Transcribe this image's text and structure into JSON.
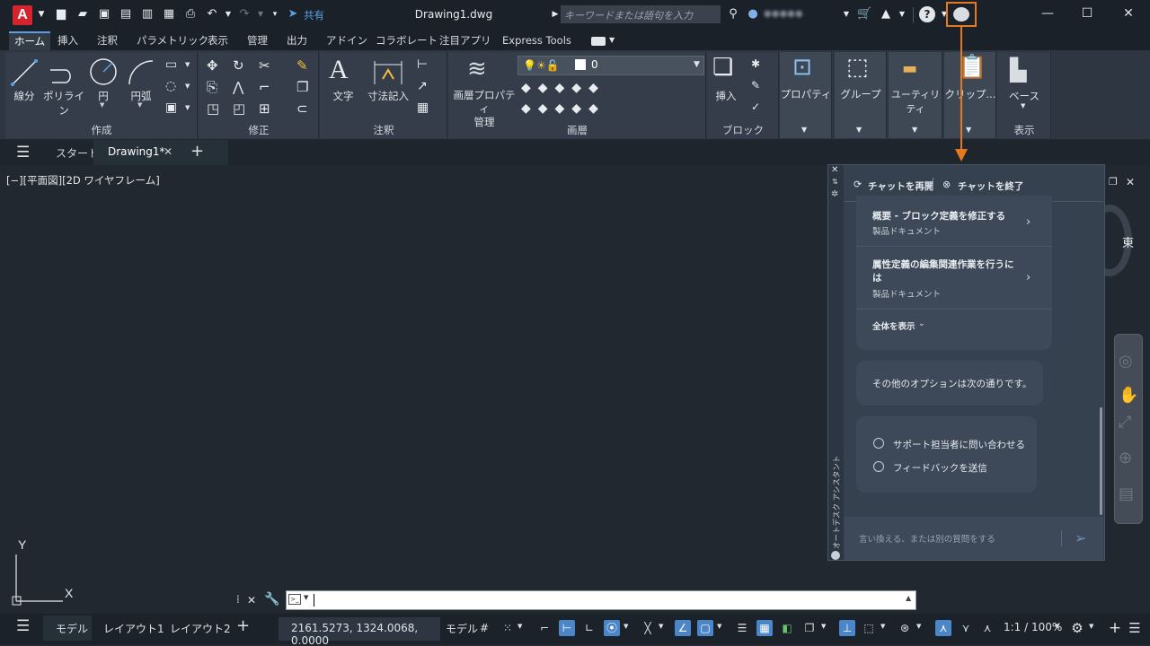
{
  "window": {
    "title": "Drawing1.dwg",
    "search_placeholder": "キーワードまたは語句を入力",
    "share": "共有",
    "user_name": "●●●●●"
  },
  "ribbon_tabs": [
    "ホーム",
    "挿入",
    "注釈",
    "パラメトリック",
    "表示",
    "管理",
    "出力",
    "アドイン",
    "コラボレート",
    "注目アプリ",
    "Express Tools"
  ],
  "ribbon": {
    "draw": {
      "line": "線分",
      "polyline": "ポリライン",
      "circle": "円",
      "arc": "円弧",
      "panel": "作成"
    },
    "modify": {
      "panel": "修正"
    },
    "annotation": {
      "text": "文字",
      "dimension": "寸法記入",
      "panel": "注釈"
    },
    "layers": {
      "properties": "画層プロパティ\n管理",
      "current_layer": "0",
      "panel": "画層"
    },
    "block": {
      "insert": "挿入",
      "panel": "ブロック"
    },
    "properties": "プロパティ",
    "groups": "グループ",
    "utilities": "ユーティリティ",
    "clipboard": "クリップ...",
    "view": {
      "base": "ベース",
      "panel": "表示"
    }
  },
  "doc_tabs": {
    "start": "スタート",
    "active": "Drawing1*"
  },
  "viewport": {
    "label": "[−][平面図][2D ワイヤフレーム]",
    "viewcube_face": "東"
  },
  "chat": {
    "restart": "チャットを再開",
    "end": "チャットを終了",
    "side_label": "オートデスク アシスタント",
    "results": [
      {
        "title": "概要 - ブロック定義を修正する",
        "source": "製品ドキュメント"
      },
      {
        "title": "属性定義の編集関連作業を行うには",
        "source": "製品ドキュメント"
      }
    ],
    "show_all": "全体を表示",
    "options_intro": "その他のオプションは次の通りです。",
    "options": [
      "サポート担当者に問い合わせる",
      "フィードバックを送信"
    ],
    "input_placeholder": "言い換える、または別の質問をする"
  },
  "statusbar": {
    "model_tab": "モデル",
    "layout1": "レイアウト1",
    "layout2": "レイアウト2",
    "coordinates": "2161.5273, 1324.0068, 0.0000",
    "model_space": "モデル",
    "scale": "1:1 / 100%"
  },
  "colors": {
    "highlight": "#e6791f",
    "toggle_on": "#4b86c9",
    "brand": "#d4242e"
  }
}
